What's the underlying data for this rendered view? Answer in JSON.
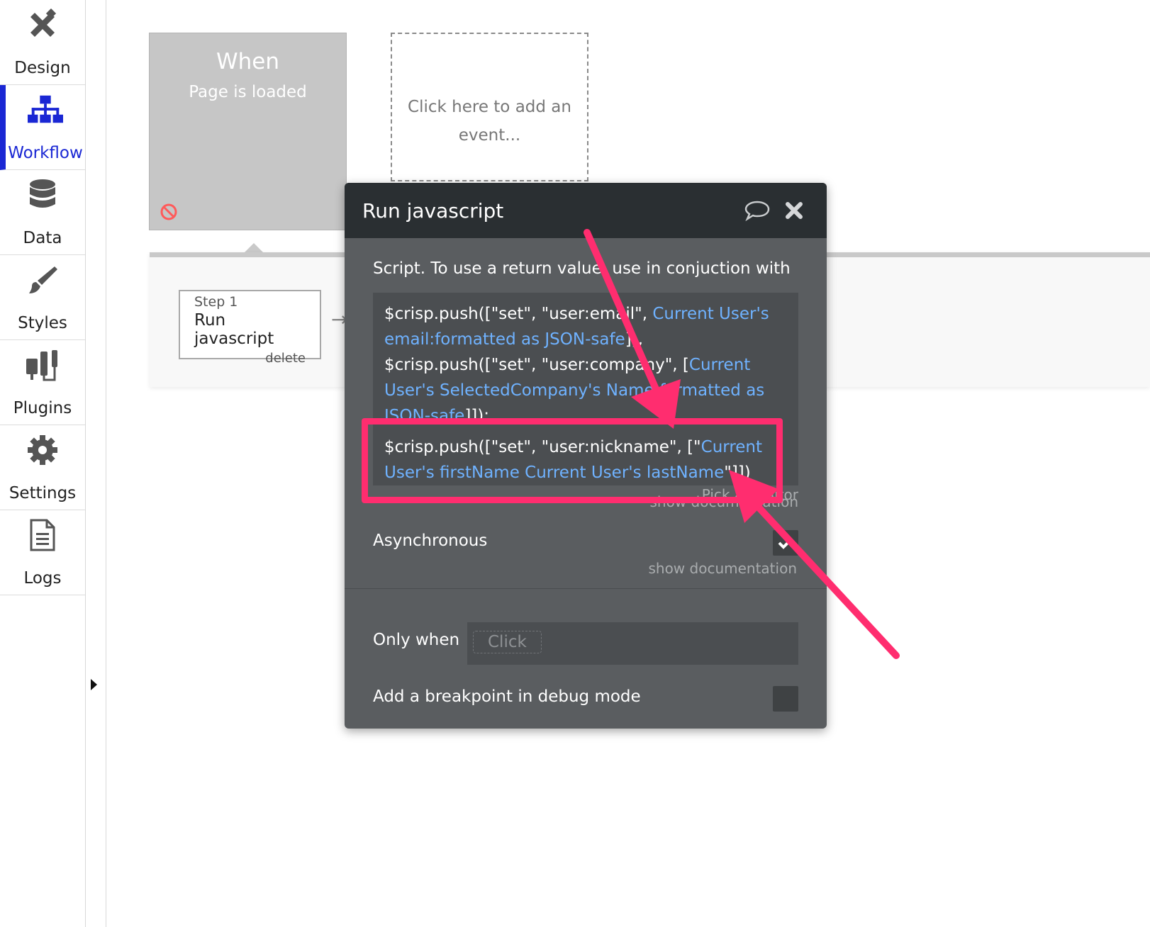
{
  "sidebar": {
    "items": [
      {
        "label": "Design",
        "icon": "design-tools-icon"
      },
      {
        "label": "Workflow",
        "icon": "workflow-tree-icon",
        "active": true
      },
      {
        "label": "Data",
        "icon": "database-icon"
      },
      {
        "label": "Styles",
        "icon": "paintbrush-icon"
      },
      {
        "label": "Plugins",
        "icon": "plug-icon"
      },
      {
        "label": "Settings",
        "icon": "gear-icon"
      },
      {
        "label": "Logs",
        "icon": "document-icon"
      }
    ]
  },
  "events": {
    "when_title": "When",
    "when_subtitle": "Page is loaded",
    "add_event_text": "Click here to add an event..."
  },
  "step": {
    "number": "Step 1",
    "name": "Run javascript",
    "delete": "delete"
  },
  "modal": {
    "title": "Run javascript",
    "script_label": "Script. To use a return value, use in conjuction with",
    "script": {
      "l1_a": "$crisp.push([\"set\", \"user:email\", ",
      "l1_b": "Current User's email:formatted as JSON-safe",
      "l1_c": "]),",
      "l2_a": "$crisp.push([\"set\", \"user:company\", [",
      "l2_b": "Current User's SelectedCompany's Name:formatted as JSON-safe",
      "l2_c": "]]);",
      "l3_a": "$crisp.push([\"set\", \"user:nickname\", [\"",
      "l3_b": "Current User's firstName Current User's lastName",
      "l3_c": "\"]])"
    },
    "expression_editor": "Pick an editor",
    "show_documentation_1": "show documentation",
    "async_label": "Asynchronous",
    "async_checked": true,
    "show_documentation_2": "show documentation",
    "only_when_label": "Only when",
    "only_when_placeholder": "Click",
    "breakpoint_label": "Add a breakpoint in debug mode",
    "breakpoint_checked": false
  },
  "colors": {
    "accent": "#1a27d4",
    "dynamic_text": "#6fb2ff",
    "annotation": "#ff2d6f",
    "modal_bg": "#5a5d60",
    "modal_header": "#2a2f32"
  }
}
